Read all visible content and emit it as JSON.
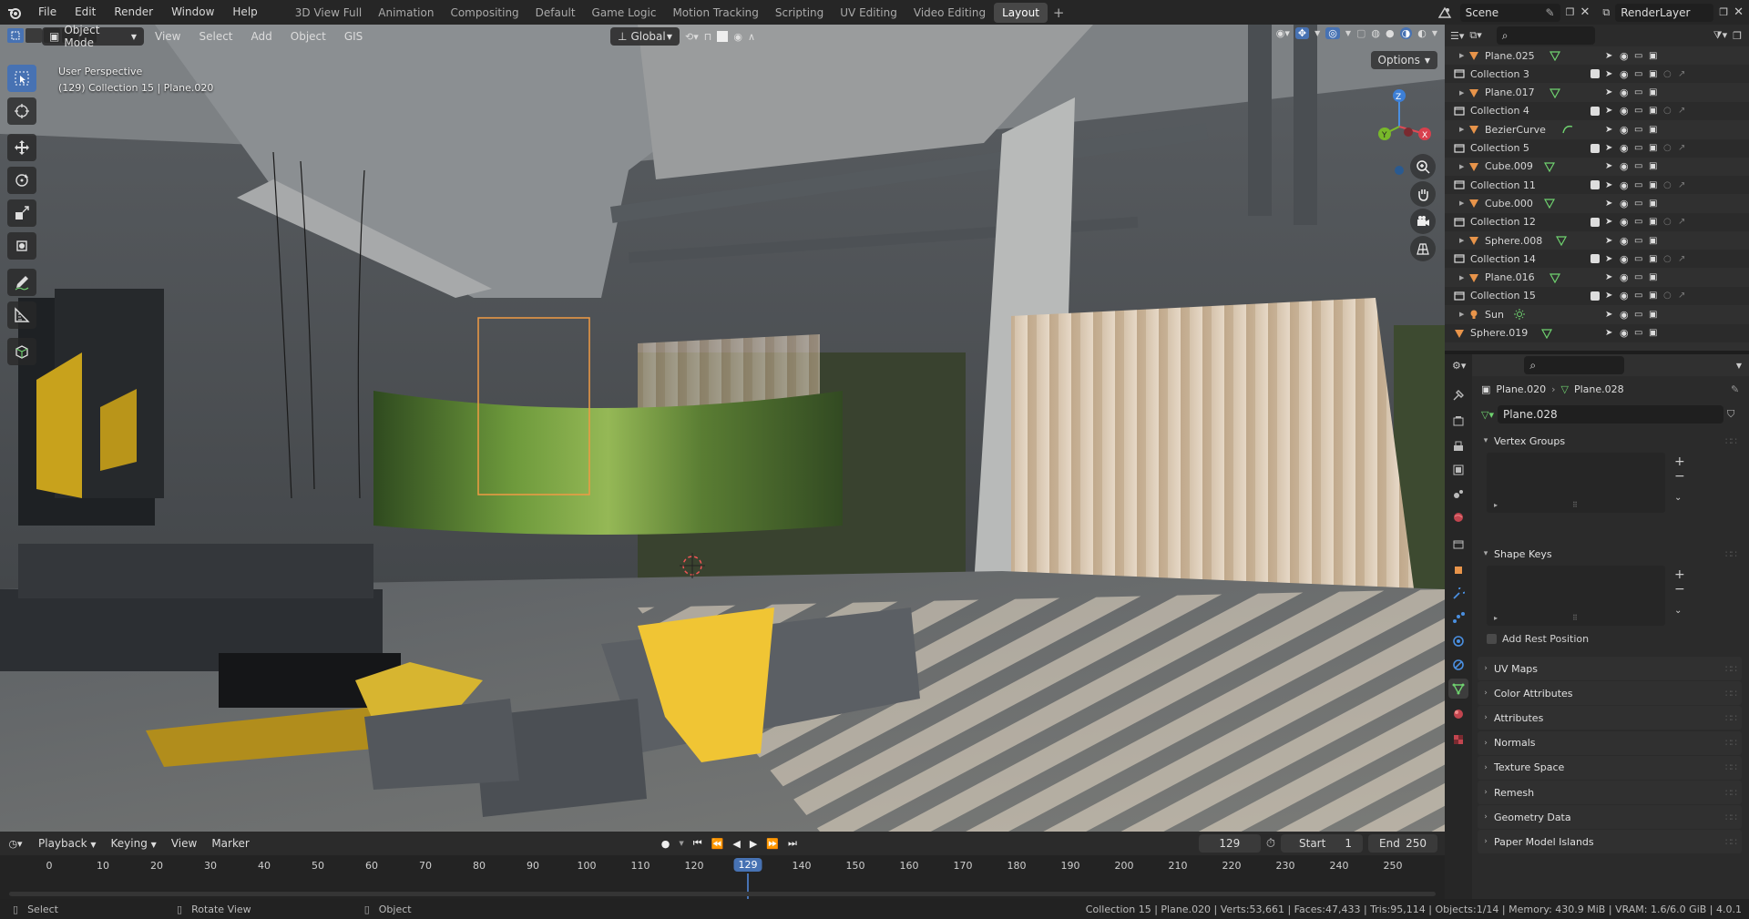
{
  "menubar": {
    "items": [
      "File",
      "Edit",
      "Render",
      "Window",
      "Help"
    ],
    "workspaces": [
      "3D View Full",
      "Animation",
      "Compositing",
      "Default",
      "Game Logic",
      "Motion Tracking",
      "Scripting",
      "UV Editing",
      "Video Editing",
      "Layout"
    ],
    "active_workspace": "Layout",
    "scene": "Scene",
    "view_layer": "RenderLayer"
  },
  "viewport": {
    "mode": "Object Mode",
    "menus": [
      "View",
      "Select",
      "Add",
      "Object",
      "GIS"
    ],
    "transform_orientation": "Global",
    "options_label": "Options",
    "overlay_title": "User Perspective",
    "overlay_subtitle": "(129) Collection 15 | Plane.020",
    "gizmo_x": "X",
    "gizmo_y": "Y",
    "gizmo_z": "Z"
  },
  "outliner": {
    "rows": [
      {
        "name": "Plane.025",
        "kind": "mesh",
        "indent": 1,
        "checkbox": false
      },
      {
        "name": "Collection 3",
        "kind": "collection",
        "indent": 0,
        "checkbox": true
      },
      {
        "name": "Plane.017",
        "kind": "mesh",
        "indent": 1,
        "checkbox": false
      },
      {
        "name": "Collection 4",
        "kind": "collection",
        "indent": 0,
        "checkbox": true
      },
      {
        "name": "BezierCurve",
        "kind": "curve",
        "indent": 1,
        "checkbox": false
      },
      {
        "name": "Collection 5",
        "kind": "collection",
        "indent": 0,
        "checkbox": true
      },
      {
        "name": "Cube.009",
        "kind": "mesh",
        "indent": 1,
        "checkbox": false
      },
      {
        "name": "Collection 11",
        "kind": "collection",
        "indent": 0,
        "checkbox": true
      },
      {
        "name": "Cube.000",
        "kind": "mesh",
        "indent": 1,
        "checkbox": false
      },
      {
        "name": "Collection 12",
        "kind": "collection",
        "indent": 0,
        "checkbox": true
      },
      {
        "name": "Sphere.008",
        "kind": "mesh",
        "indent": 1,
        "checkbox": false
      },
      {
        "name": "Collection 14",
        "kind": "collection",
        "indent": 0,
        "checkbox": true
      },
      {
        "name": "Plane.016",
        "kind": "mesh",
        "indent": 1,
        "checkbox": false
      },
      {
        "name": "Collection 15",
        "kind": "collection",
        "indent": 0,
        "checkbox": true
      },
      {
        "name": "Sun",
        "kind": "light",
        "indent": 1,
        "checkbox": false
      },
      {
        "name": "Sphere.019",
        "kind": "mesh",
        "indent": 0,
        "checkbox": false
      }
    ]
  },
  "properties": {
    "breadcrumb_object": "Plane.020",
    "breadcrumb_data": "Plane.028",
    "mesh_name": "Plane.028",
    "vertex_groups_label": "Vertex Groups",
    "shape_keys_label": "Shape Keys",
    "add_rest_position_label": "Add Rest Position",
    "collapsed_sections": [
      "UV Maps",
      "Color Attributes",
      "Attributes",
      "Normals",
      "Texture Space",
      "Remesh",
      "Geometry Data",
      "Paper Model Islands"
    ]
  },
  "timeline": {
    "menus": [
      "Playback",
      "Keying",
      "View",
      "Marker"
    ],
    "current_frame": "129",
    "start_label": "Start",
    "start_value": "1",
    "end_label": "End",
    "end_value": "250",
    "ticks": [
      "0",
      "10",
      "20",
      "30",
      "40",
      "50",
      "60",
      "70",
      "80",
      "90",
      "100",
      "110",
      "120",
      "129",
      "140",
      "150",
      "160",
      "170",
      "180",
      "190",
      "200",
      "210",
      "220",
      "230",
      "240",
      "250"
    ]
  },
  "statusbar": {
    "select_label": "Select",
    "rotate_label": "Rotate View",
    "object_label": "Object",
    "stats": "Collection 15 | Plane.020 | Verts:53,661 | Faces:47,433 | Tris:95,114 | Objects:1/14 | Memory: 430.9 MiB | VRAM: 1.6/6.0 GiB | 4.0.1"
  },
  "colors": {
    "accent": "#4772b3",
    "mesh": "#e8944a",
    "data": "#6fd26f",
    "selection": "#f09b44"
  }
}
